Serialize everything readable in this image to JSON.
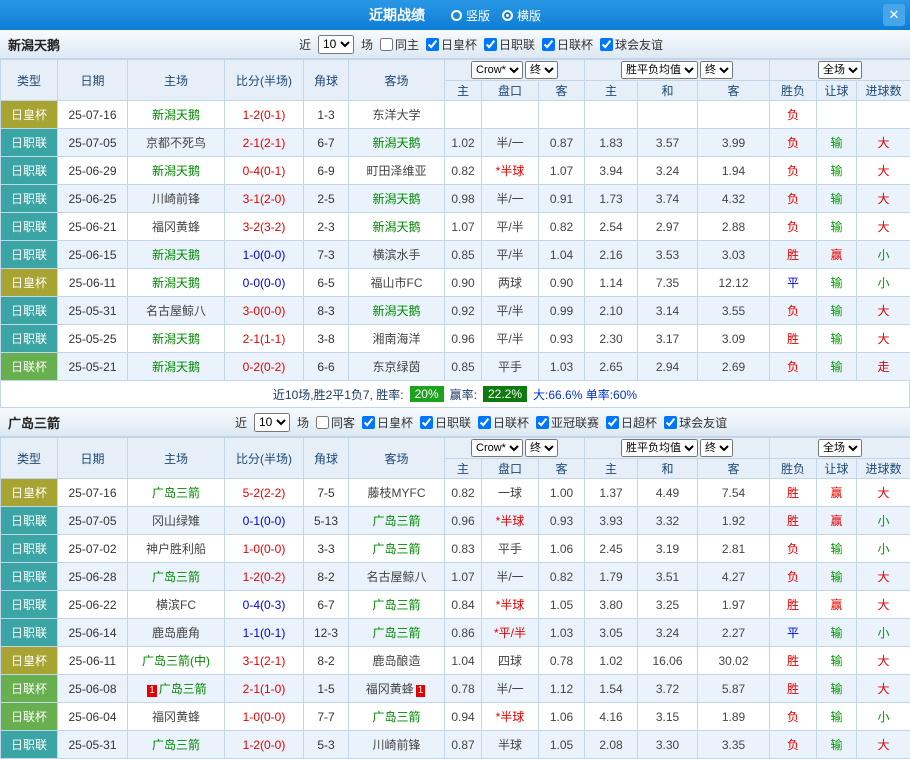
{
  "colors": {
    "palette": {
      "red": "#e60000",
      "blue": "#0000dd",
      "green": "#009900",
      "team": "#008800",
      "badge1": "#1ea11e",
      "badge2": "#0c7a0c",
      "topbar": "#0d7ed6",
      "header_bg": "#e6eef8",
      "row_alt": "#eaf3fb",
      "border": "#c3d5e8"
    },
    "type": {
      "日皇杯": "#a8a433",
      "日职联": "#3ba5a5",
      "日联杯": "#68af4f"
    }
  },
  "topbar": {
    "title": "近期战绩",
    "radios": [
      {
        "label": "竖版",
        "selected": false
      },
      {
        "label": "横版",
        "selected": true
      }
    ],
    "close_icon": "✕"
  },
  "table_header": {
    "cols": [
      "类型",
      "日期",
      "主场",
      "比分(半场)",
      "角球",
      "客场"
    ],
    "select_groups": [
      [
        "Crow*",
        "终"
      ],
      [
        "胜平负均值",
        "终"
      ],
      [
        "全场"
      ]
    ],
    "sub": [
      "主",
      "盘口",
      "客",
      "主",
      "和",
      "客",
      "胜负",
      "让球",
      "进球数"
    ]
  },
  "sections": [
    {
      "team": "新潟天鹅",
      "near_label": "近",
      "near_count": "10",
      "near_suffix": "场",
      "filters": [
        {
          "label": "同主",
          "checked": false
        },
        {
          "label": "日皇杯",
          "checked": true
        },
        {
          "label": "日职联",
          "checked": true
        },
        {
          "label": "日联杯",
          "checked": true
        },
        {
          "label": "球会友谊",
          "checked": true
        }
      ],
      "rows": [
        {
          "type": "日皇杯",
          "date": "25-07-16",
          "home": "新潟天鹅",
          "home_team": true,
          "home_badge": "",
          "score": "1-2(0-1)",
          "score_color": "red",
          "corner": "1-3",
          "away": "东洋大学",
          "away_team": false,
          "away_badge": "",
          "asian": [
            "",
            "",
            ""
          ],
          "asian_red": false,
          "euro": [
            "",
            "",
            ""
          ],
          "result": "负",
          "result_color": "r",
          "hres": "",
          "hres_color": "g",
          "goals": "",
          "goals_color": "r"
        },
        {
          "type": "日职联",
          "date": "25-07-05",
          "home": "京都不死鸟",
          "home_team": false,
          "home_badge": "",
          "score": "2-1(2-1)",
          "score_color": "red",
          "corner": "6-7",
          "away": "新潟天鹅",
          "away_team": true,
          "away_badge": "",
          "asian": [
            "1.02",
            "半/一",
            "0.87"
          ],
          "asian_red": false,
          "euro": [
            "1.83",
            "3.57",
            "3.99"
          ],
          "result": "负",
          "result_color": "r",
          "hres": "输",
          "hres_color": "g",
          "goals": "大",
          "goals_color": "r"
        },
        {
          "type": "日职联",
          "date": "25-06-29",
          "home": "新潟天鹅",
          "home_team": true,
          "home_badge": "",
          "score": "0-4(0-1)",
          "score_color": "red",
          "corner": "6-9",
          "away": "町田泽维亚",
          "away_team": false,
          "away_badge": "",
          "asian": [
            "0.82",
            "*半球",
            "1.07"
          ],
          "asian_red": true,
          "euro": [
            "3.94",
            "3.24",
            "1.94"
          ],
          "result": "负",
          "result_color": "r",
          "hres": "输",
          "hres_color": "g",
          "goals": "大",
          "goals_color": "r"
        },
        {
          "type": "日职联",
          "date": "25-06-25",
          "home": "川崎前锋",
          "home_team": false,
          "home_badge": "",
          "score": "3-1(2-0)",
          "score_color": "red",
          "corner": "2-5",
          "away": "新潟天鹅",
          "away_team": true,
          "away_badge": "",
          "asian": [
            "0.98",
            "半/一",
            "0.91"
          ],
          "asian_red": false,
          "euro": [
            "1.73",
            "3.74",
            "4.32"
          ],
          "result": "负",
          "result_color": "r",
          "hres": "输",
          "hres_color": "g",
          "goals": "大",
          "goals_color": "r"
        },
        {
          "type": "日职联",
          "date": "25-06-21",
          "home": "福冈黄蜂",
          "home_team": false,
          "home_badge": "",
          "score": "3-2(3-2)",
          "score_color": "red",
          "corner": "2-3",
          "away": "新潟天鹅",
          "away_team": true,
          "away_badge": "",
          "asian": [
            "1.07",
            "平/半",
            "0.82"
          ],
          "asian_red": false,
          "euro": [
            "2.54",
            "2.97",
            "2.88"
          ],
          "result": "负",
          "result_color": "r",
          "hres": "输",
          "hres_color": "g",
          "goals": "大",
          "goals_color": "r"
        },
        {
          "type": "日职联",
          "date": "25-06-15",
          "home": "新潟天鹅",
          "home_team": true,
          "home_badge": "",
          "score": "1-0(0-0)",
          "score_color": "blue",
          "corner": "7-3",
          "away": "横滨水手",
          "away_team": false,
          "away_badge": "",
          "asian": [
            "0.85",
            "平/半",
            "1.04"
          ],
          "asian_red": false,
          "euro": [
            "2.16",
            "3.53",
            "3.03"
          ],
          "result": "胜",
          "result_color": "r",
          "hres": "赢",
          "hres_color": "r",
          "goals": "小",
          "goals_color": "g"
        },
        {
          "type": "日皇杯",
          "date": "25-06-11",
          "home": "新潟天鹅",
          "home_team": true,
          "home_badge": "",
          "score": "0-0(0-0)",
          "score_color": "blue",
          "corner": "6-5",
          "away": "福山市FC",
          "away_team": false,
          "away_badge": "",
          "asian": [
            "0.90",
            "两球",
            "0.90"
          ],
          "asian_red": false,
          "euro": [
            "1.14",
            "7.35",
            "12.12"
          ],
          "result": "平",
          "result_color": "b",
          "hres": "输",
          "hres_color": "g",
          "goals": "小",
          "goals_color": "g"
        },
        {
          "type": "日职联",
          "date": "25-05-31",
          "home": "名古屋鲸八",
          "home_team": false,
          "home_badge": "",
          "score": "3-0(0-0)",
          "score_color": "red",
          "corner": "8-3",
          "away": "新潟天鹅",
          "away_team": true,
          "away_badge": "",
          "asian": [
            "0.92",
            "平/半",
            "0.99"
          ],
          "asian_red": false,
          "euro": [
            "2.10",
            "3.14",
            "3.55"
          ],
          "result": "负",
          "result_color": "r",
          "hres": "输",
          "hres_color": "g",
          "goals": "大",
          "goals_color": "r"
        },
        {
          "type": "日职联",
          "date": "25-05-25",
          "home": "新潟天鹅",
          "home_team": true,
          "home_badge": "",
          "score": "2-1(1-1)",
          "score_color": "red",
          "corner": "3-8",
          "away": "湘南海洋",
          "away_team": false,
          "away_badge": "",
          "asian": [
            "0.96",
            "平/半",
            "0.93"
          ],
          "asian_red": false,
          "euro": [
            "2.30",
            "3.17",
            "3.09"
          ],
          "result": "胜",
          "result_color": "r",
          "hres": "输",
          "hres_color": "g",
          "goals": "大",
          "goals_color": "r"
        },
        {
          "type": "日联杯",
          "date": "25-05-21",
          "home": "新潟天鹅",
          "home_team": true,
          "home_badge": "",
          "score": "0-2(0-2)",
          "score_color": "red",
          "corner": "6-6",
          "away": "东京绿茵",
          "away_team": false,
          "away_badge": "",
          "asian": [
            "0.85",
            "平手",
            "1.03"
          ],
          "asian_red": false,
          "euro": [
            "2.65",
            "2.94",
            "2.69"
          ],
          "result": "负",
          "result_color": "r",
          "hres": "输",
          "hres_color": "g",
          "goals": "走",
          "goals_color": "r"
        }
      ],
      "summary": {
        "lead": "近10场,胜2平1负7, 胜率:",
        "badge1": "20%",
        "mid": "赢率:",
        "badge2": "22.2%",
        "tail": "大:66.6% 单率:60%"
      }
    },
    {
      "team": "广岛三箭",
      "near_label": "近",
      "near_count": "10",
      "near_suffix": "场",
      "filters": [
        {
          "label": "同客",
          "checked": false
        },
        {
          "label": "日皇杯",
          "checked": true
        },
        {
          "label": "日职联",
          "checked": true
        },
        {
          "label": "日联杯",
          "checked": true
        },
        {
          "label": "亚冠联赛",
          "checked": true
        },
        {
          "label": "日超杯",
          "checked": true
        },
        {
          "label": "球会友谊",
          "checked": true
        }
      ],
      "rows": [
        {
          "type": "日皇杯",
          "date": "25-07-16",
          "home": "广岛三箭",
          "home_team": true,
          "home_badge": "",
          "score": "5-2(2-2)",
          "score_color": "red",
          "corner": "7-5",
          "away": "藤枝MYFC",
          "away_team": false,
          "away_badge": "",
          "asian": [
            "0.82",
            "一球",
            "1.00"
          ],
          "asian_red": false,
          "euro": [
            "1.37",
            "4.49",
            "7.54"
          ],
          "result": "胜",
          "result_color": "r",
          "hres": "赢",
          "hres_color": "r",
          "goals": "大",
          "goals_color": "r"
        },
        {
          "type": "日职联",
          "date": "25-07-05",
          "home": "冈山绿雉",
          "home_team": false,
          "home_badge": "",
          "score": "0-1(0-0)",
          "score_color": "blue",
          "corner": "5-13",
          "away": "广岛三箭",
          "away_team": true,
          "away_badge": "",
          "asian": [
            "0.96",
            "*半球",
            "0.93"
          ],
          "asian_red": true,
          "euro": [
            "3.93",
            "3.32",
            "1.92"
          ],
          "result": "胜",
          "result_color": "r",
          "hres": "赢",
          "hres_color": "r",
          "goals": "小",
          "goals_color": "g"
        },
        {
          "type": "日职联",
          "date": "25-07-02",
          "home": "神户胜利船",
          "home_team": false,
          "home_badge": "",
          "score": "1-0(0-0)",
          "score_color": "red",
          "corner": "3-3",
          "away": "广岛三箭",
          "away_team": true,
          "away_badge": "",
          "asian": [
            "0.83",
            "平手",
            "1.06"
          ],
          "asian_red": false,
          "euro": [
            "2.45",
            "3.19",
            "2.81"
          ],
          "result": "负",
          "result_color": "r",
          "hres": "输",
          "hres_color": "g",
          "goals": "小",
          "goals_color": "g"
        },
        {
          "type": "日职联",
          "date": "25-06-28",
          "home": "广岛三箭",
          "home_team": true,
          "home_badge": "",
          "score": "1-2(0-2)",
          "score_color": "red",
          "corner": "8-2",
          "away": "名古屋鲸八",
          "away_team": false,
          "away_badge": "",
          "asian": [
            "1.07",
            "半/一",
            "0.82"
          ],
          "asian_red": false,
          "euro": [
            "1.79",
            "3.51",
            "4.27"
          ],
          "result": "负",
          "result_color": "r",
          "hres": "输",
          "hres_color": "g",
          "goals": "大",
          "goals_color": "r"
        },
        {
          "type": "日职联",
          "date": "25-06-22",
          "home": "横滨FC",
          "home_team": false,
          "home_badge": "",
          "score": "0-4(0-3)",
          "score_color": "blue",
          "corner": "6-7",
          "away": "广岛三箭",
          "away_team": true,
          "away_badge": "",
          "asian": [
            "0.84",
            "*半球",
            "1.05"
          ],
          "asian_red": true,
          "euro": [
            "3.80",
            "3.25",
            "1.97"
          ],
          "result": "胜",
          "result_color": "r",
          "hres": "赢",
          "hres_color": "r",
          "goals": "大",
          "goals_color": "r"
        },
        {
          "type": "日职联",
          "date": "25-06-14",
          "home": "鹿岛鹿角",
          "home_team": false,
          "home_badge": "",
          "score": "1-1(0-1)",
          "score_color": "blue",
          "corner": "12-3",
          "away": "广岛三箭",
          "away_team": true,
          "away_badge": "",
          "asian": [
            "0.86",
            "*平/半",
            "1.03"
          ],
          "asian_red": true,
          "euro": [
            "3.05",
            "3.24",
            "2.27"
          ],
          "result": "平",
          "result_color": "b",
          "hres": "输",
          "hres_color": "g",
          "goals": "小",
          "goals_color": "g"
        },
        {
          "type": "日皇杯",
          "date": "25-06-11",
          "home": "广岛三箭(中)",
          "home_team": true,
          "home_badge": "",
          "score": "3-1(2-1)",
          "score_color": "red",
          "corner": "8-2",
          "away": "鹿岛酿造",
          "away_team": false,
          "away_badge": "",
          "asian": [
            "1.04",
            "四球",
            "0.78"
          ],
          "asian_red": false,
          "euro": [
            "1.02",
            "16.06",
            "30.02"
          ],
          "result": "胜",
          "result_color": "r",
          "hres": "输",
          "hres_color": "g",
          "goals": "大",
          "goals_color": "r"
        },
        {
          "type": "日联杯",
          "date": "25-06-08",
          "home": "广岛三箭",
          "home_team": true,
          "home_badge": "1",
          "score": "2-1(1-0)",
          "score_color": "red",
          "corner": "1-5",
          "away": "福冈黄蜂",
          "away_team": false,
          "away_badge": "1",
          "asian": [
            "0.78",
            "半/一",
            "1.12"
          ],
          "asian_red": false,
          "euro": [
            "1.54",
            "3.72",
            "5.87"
          ],
          "result": "胜",
          "result_color": "r",
          "hres": "输",
          "hres_color": "g",
          "goals": "大",
          "goals_color": "r"
        },
        {
          "type": "日联杯",
          "date": "25-06-04",
          "home": "福冈黄蜂",
          "home_team": false,
          "home_badge": "",
          "score": "1-0(0-0)",
          "score_color": "red",
          "corner": "7-7",
          "away": "广岛三箭",
          "away_team": true,
          "away_badge": "",
          "asian": [
            "0.94",
            "*半球",
            "1.06"
          ],
          "asian_red": true,
          "euro": [
            "4.16",
            "3.15",
            "1.89"
          ],
          "result": "负",
          "result_color": "r",
          "hres": "输",
          "hres_color": "g",
          "goals": "小",
          "goals_color": "g"
        },
        {
          "type": "日职联",
          "date": "25-05-31",
          "home": "广岛三箭",
          "home_team": true,
          "home_badge": "",
          "score": "1-2(0-0)",
          "score_color": "red",
          "corner": "5-3",
          "away": "川崎前锋",
          "away_team": false,
          "away_badge": "",
          "asian": [
            "0.87",
            "半球",
            "1.05"
          ],
          "asian_red": false,
          "euro": [
            "2.08",
            "3.30",
            "3.35"
          ],
          "result": "负",
          "result_color": "r",
          "hres": "输",
          "hres_color": "g",
          "goals": "大",
          "goals_color": "r"
        }
      ]
    }
  ]
}
